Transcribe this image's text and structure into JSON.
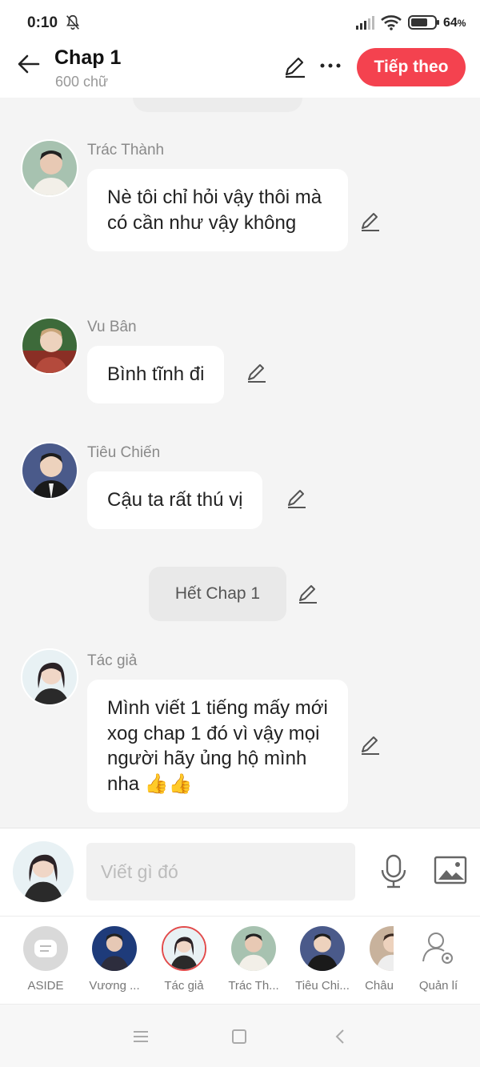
{
  "status_bar": {
    "time": "0:10",
    "battery": "64",
    "battery_unit": "%"
  },
  "header": {
    "title": "Chap 1",
    "word_count": "600 chữ",
    "next_label": "Tiếp theo"
  },
  "messages": [
    {
      "speaker": "Trác Thành",
      "text": "Nè tôi chỉ hỏi vậy thôi mà có cần như vậy không"
    },
    {
      "speaker": "Vu Bân",
      "text": "Bình tĩnh đi"
    },
    {
      "speaker": "Tiêu Chiến",
      "text": "Cậu ta rất thú vị"
    },
    {
      "speaker": "Tác giả",
      "text": "Mình viết 1 tiếng mấy mới xog chap 1 đó vì vậy mọi người hãy ủng hộ mình nha 👍👍"
    }
  ],
  "system_message": "Hết Chap 1",
  "composer": {
    "placeholder": "Viết gì đó"
  },
  "characters": [
    {
      "label": "ASIDE",
      "icon": "aside-chat-icon"
    },
    {
      "label": "Vương ...",
      "icon": "avatar"
    },
    {
      "label": "Tác giả",
      "icon": "avatar",
      "selected": true
    },
    {
      "label": "Trác Th...",
      "icon": "avatar"
    },
    {
      "label": "Tiêu Chi...",
      "icon": "avatar"
    },
    {
      "label": "Châu",
      "icon": "avatar"
    },
    {
      "label": "Quản lí",
      "icon": "manage-user-icon"
    }
  ],
  "colors": {
    "accent": "#f4424f",
    "background": "#f4f4f4",
    "bubble": "#ffffff"
  }
}
